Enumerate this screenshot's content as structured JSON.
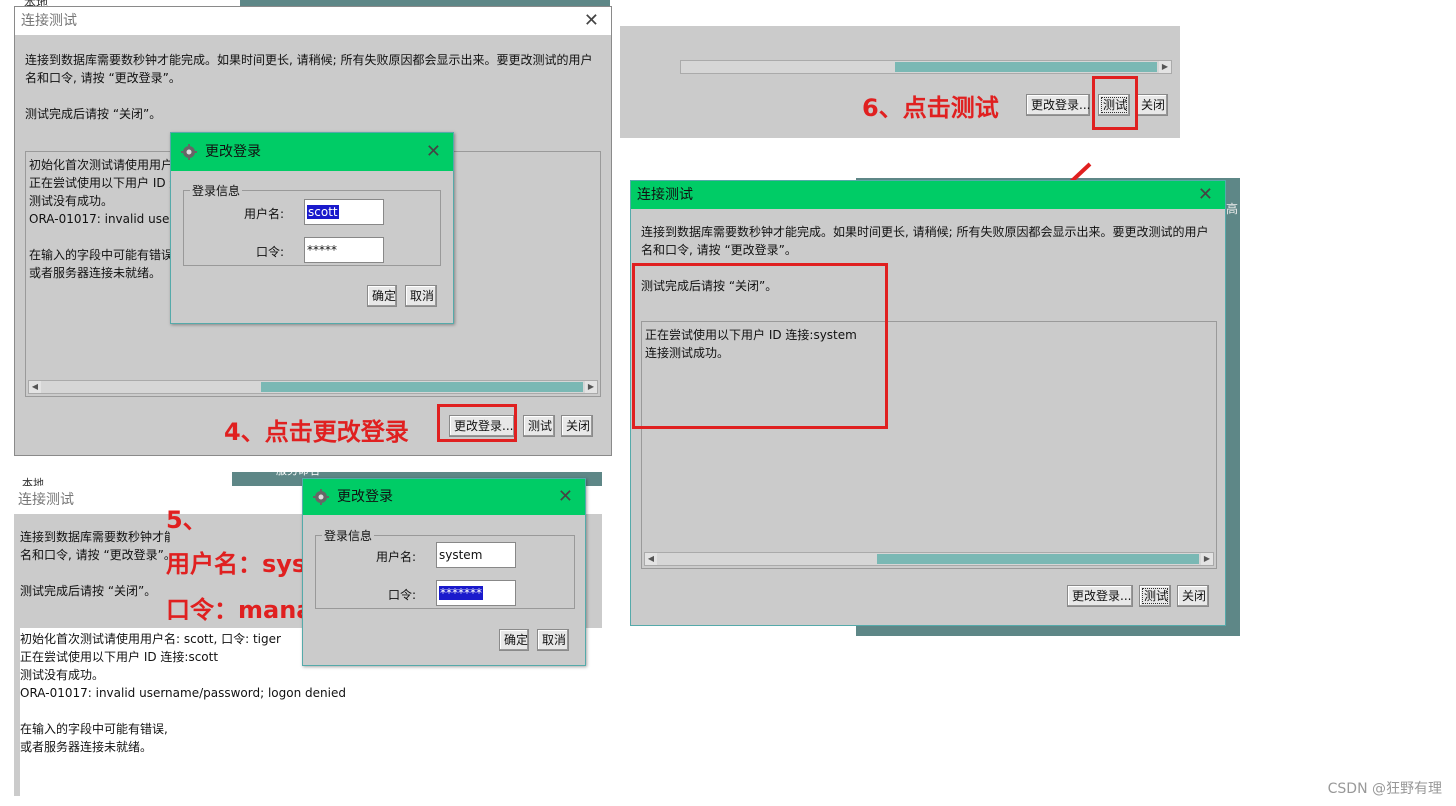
{
  "title_conn_test": "连接测试",
  "title_change_login": "更改登录",
  "desc_line1": "连接到数据库需要数秒钟才能完成。如果时间更长, 请稍候; 所有失败原因都会显示出来。要更改测试的用户",
  "desc_line2": "名和口令, 请按 “更改登录”。",
  "close_hint": "测试完成后请按 “关闭”。",
  "fail_log": [
    "初始化首次测试请使用用户名: scott, 口令: tiger",
    "正在尝试使用以下用户 ID 连接:scott",
    "测试没有成功。",
    "ORA-01017: invalid username/password; logon denied",
    "",
    "在输入的字段中可能有错误,",
    "或者服务器连接未就绪。"
  ],
  "success_log": [
    "正在尝试使用以下用户 ID 连接:system",
    "连接测试成功。"
  ],
  "buttons": {
    "change_login": "更改登录...",
    "test": "测试",
    "close": "关闭",
    "ok": "确定",
    "cancel": "取消"
  },
  "login_group": "登录信息",
  "username_label": "用户名:",
  "password_label": "口令:",
  "dialog1": {
    "username": "scott",
    "password": "*****"
  },
  "dialog2": {
    "username": "system",
    "password": "*******"
  },
  "annotations": {
    "step4": "4、点击更改登录",
    "step5": "5、",
    "step5_user": "用户名：system",
    "step5_pass": "口令：manager",
    "step6": "6、点击测试"
  },
  "bg_fragments": {
    "local1": "本地",
    "local2": "本地",
    "service": "服务命名",
    "partial": "高"
  },
  "watermark": "CSDN @狂野有理",
  "colors": {
    "accent_green": "#00cc66",
    "annotation_red": "#e02020",
    "selection_blue": "#1a1acc"
  }
}
